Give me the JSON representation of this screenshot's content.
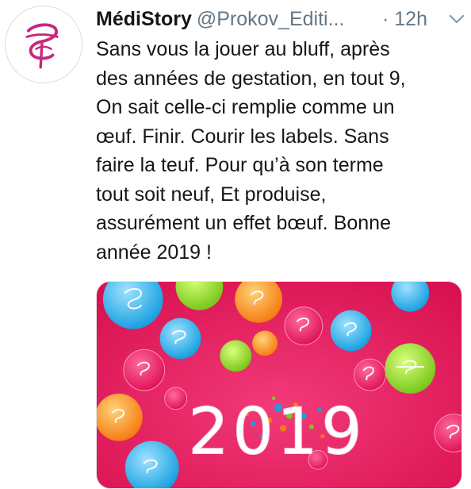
{
  "tweet": {
    "author_name": "MédiStory",
    "author_handle": "@Prokov_Editi...",
    "time_ago": "· 12h",
    "text_lines": [
      "Sans vous la jouer au bluff, après",
      "des années de gestation, en tout 9,",
      "On sait celle-ci remplie comme un",
      "œuf. Finir. Courir les labels. Sans",
      "faire la teuf. Pour qu’à son terme",
      "tout soit neuf, Et produise,",
      "assurément un effet bœuf. Bonne",
      "année 2019 !"
    ],
    "media": {
      "year_label": "2019",
      "background_color": "#e8195e"
    },
    "icons": {
      "avatar": "medistory-logo",
      "more": "chevron-down-icon"
    }
  },
  "colors": {
    "text": "#14171a",
    "secondary": "#657786",
    "brand": "#c8287e"
  }
}
